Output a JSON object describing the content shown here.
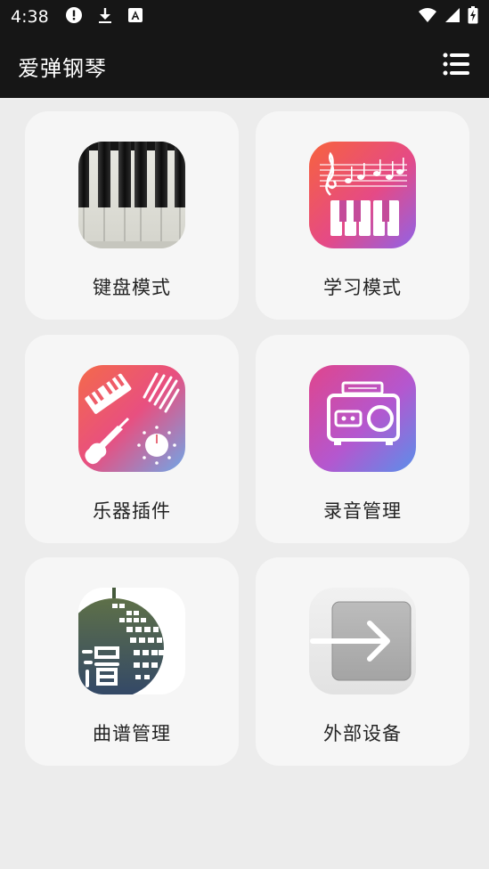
{
  "status_bar": {
    "time": "4:38",
    "icons_left": [
      "alert-icon",
      "download-icon",
      "font-icon"
    ],
    "icons_right": [
      "wifi-icon",
      "signal-icon",
      "battery-icon"
    ]
  },
  "app_bar": {
    "title": "爱弹钢琴",
    "menu_icon": "list-menu-icon"
  },
  "cards": [
    {
      "label": "键盘模式",
      "icon": "piano-keyboard-icon"
    },
    {
      "label": "学习模式",
      "icon": "music-learning-icon"
    },
    {
      "label": "乐器插件",
      "icon": "instrument-plugin-icon"
    },
    {
      "label": "录音管理",
      "icon": "radio-recorder-icon"
    },
    {
      "label": "曲谱管理",
      "icon": "sheet-music-globe-icon"
    },
    {
      "label": "外部设备",
      "icon": "external-arrow-icon"
    }
  ],
  "colors": {
    "bar": "#161616",
    "background": "#ececec",
    "card": "#f6f6f6",
    "text": "#222222"
  }
}
